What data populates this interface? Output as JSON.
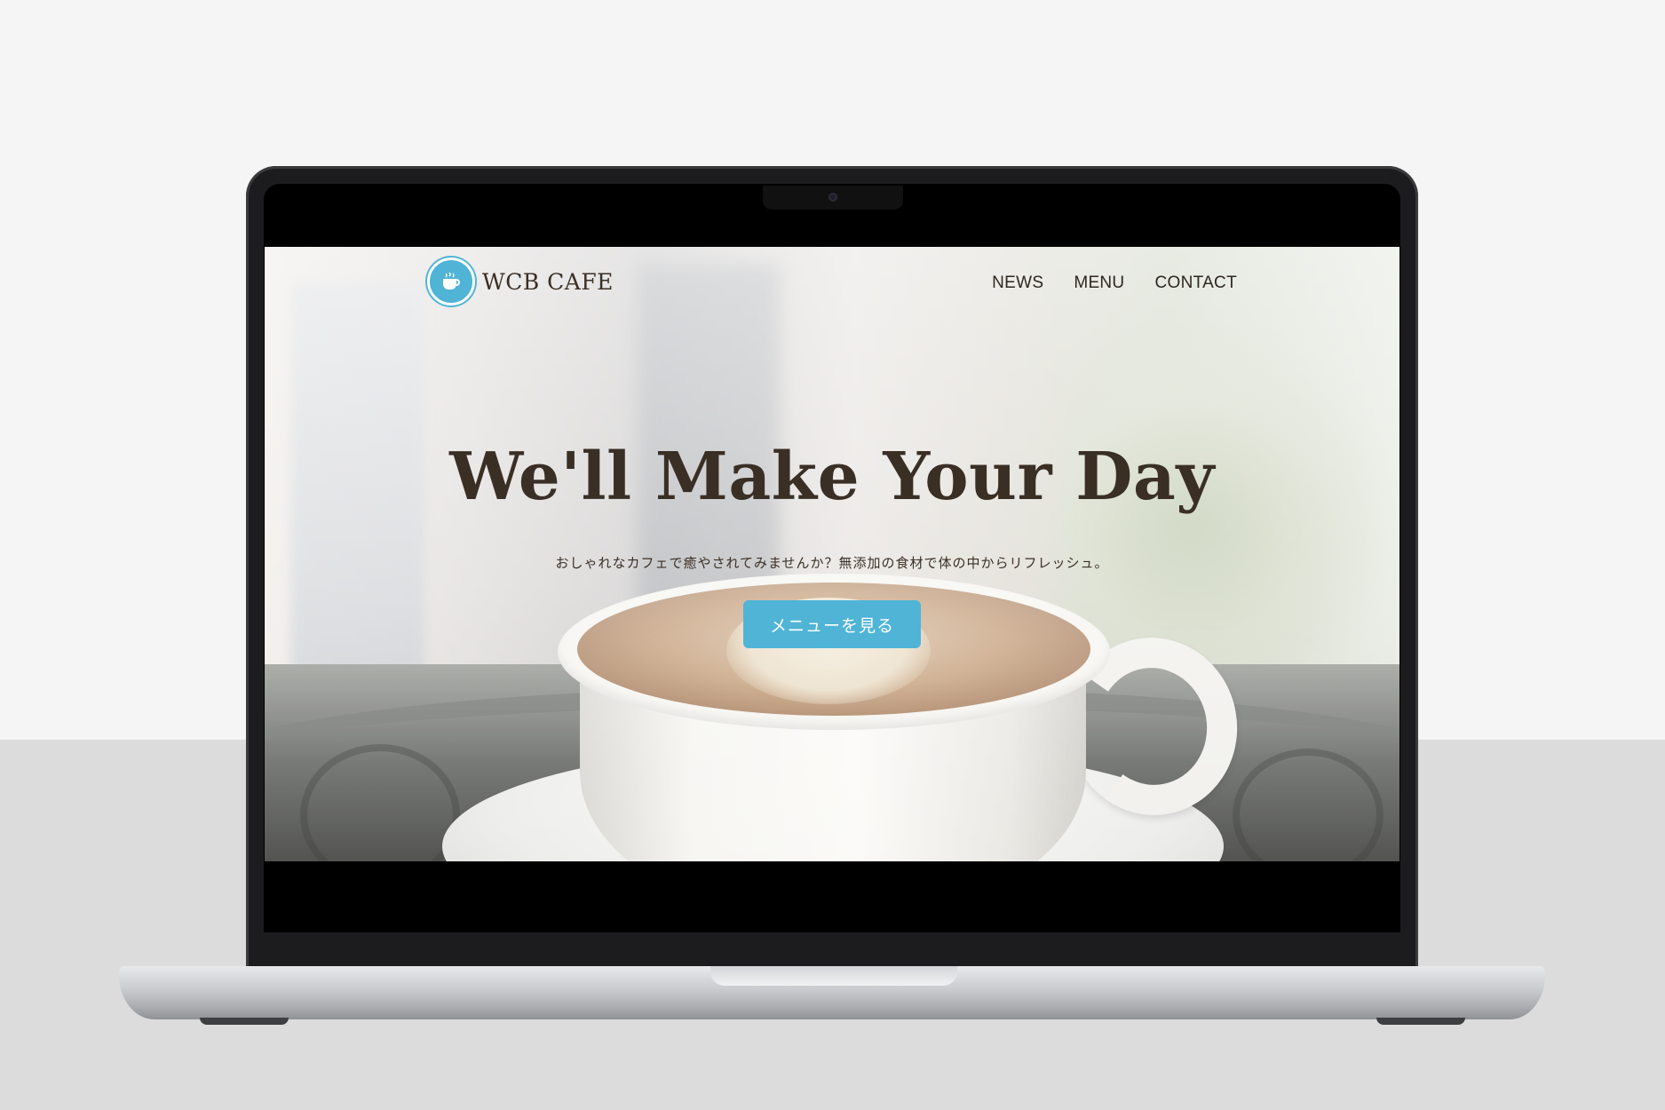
{
  "site": {
    "logo_text": "WCB CAFE",
    "logo_icon": "cafe-badge-icon"
  },
  "nav": {
    "items": [
      {
        "label": "NEWS"
      },
      {
        "label": "MENU"
      },
      {
        "label": "CONTACT"
      }
    ]
  },
  "hero": {
    "title": "We'll Make Your Day",
    "subtitle": "おしゃれなカフェで癒やされてみませんか？無添加の食材で体の中からリフレッシュ。",
    "button_label": "メニューを見る"
  },
  "colors": {
    "accent": "#4fb4d6",
    "text": "#3a2f25"
  }
}
